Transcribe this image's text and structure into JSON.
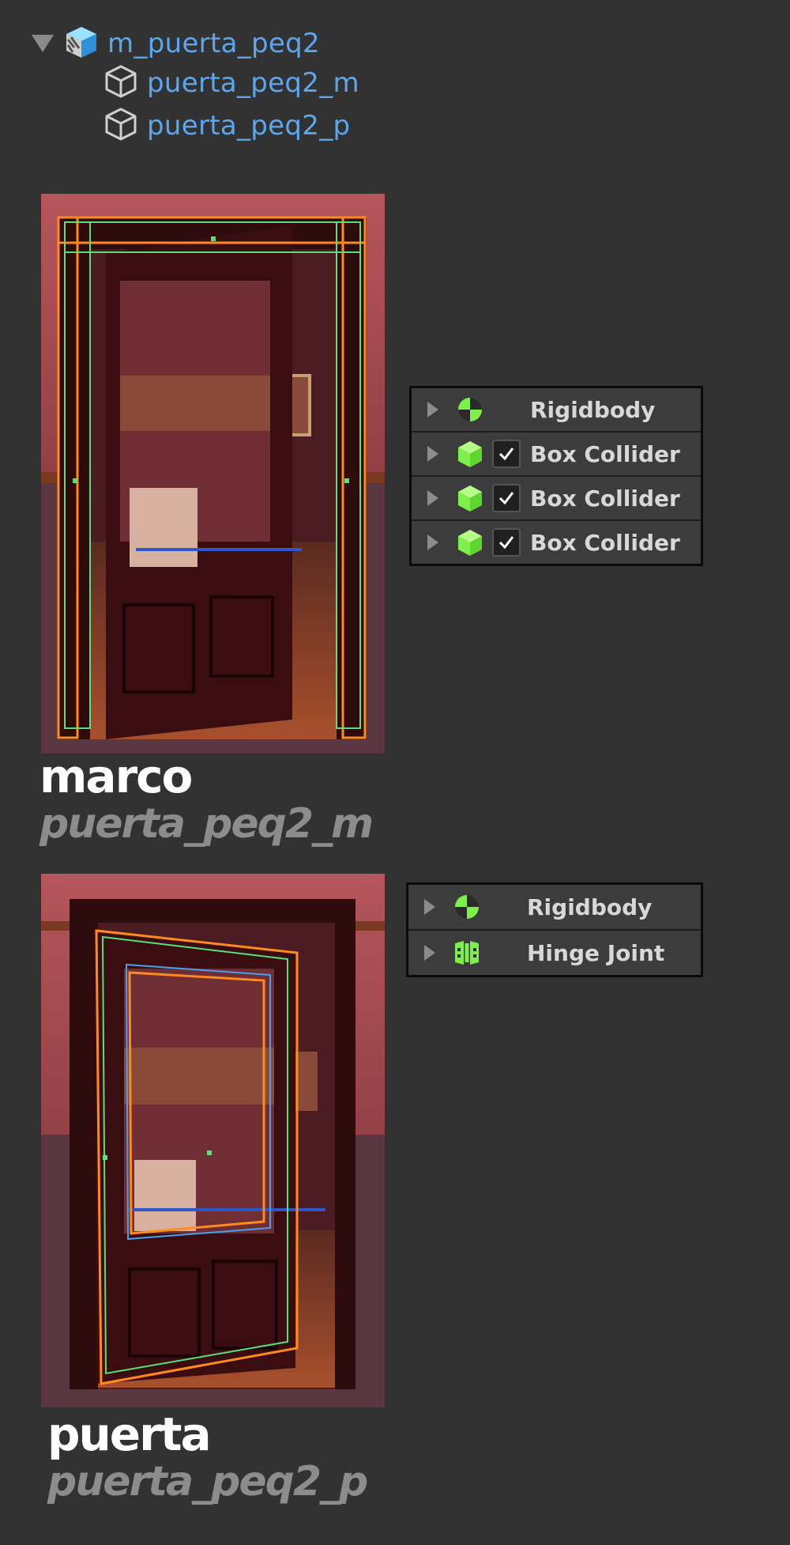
{
  "hierarchy": {
    "root": {
      "label": "m_puerta_peq2",
      "icon": "prefab-icon"
    },
    "children": [
      {
        "label": "puerta_peq2_m",
        "icon": "mesh-cube-icon"
      },
      {
        "label": "puerta_peq2_p",
        "icon": "mesh-cube-icon"
      }
    ]
  },
  "marco": {
    "title": "marco",
    "subtitle": "puerta_peq2_m",
    "components": [
      {
        "label": "Rigidbody",
        "icon": "rigidbody-icon",
        "has_checkbox": false
      },
      {
        "label": "Box Collider",
        "icon": "box-collider-icon",
        "has_checkbox": true,
        "checked": true
      },
      {
        "label": "Box Collider",
        "icon": "box-collider-icon",
        "has_checkbox": true,
        "checked": true
      },
      {
        "label": "Box Collider",
        "icon": "box-collider-icon",
        "has_checkbox": true,
        "checked": true
      }
    ]
  },
  "puerta": {
    "title": "puerta",
    "subtitle": "puerta_peq2_p",
    "components": [
      {
        "label": "Rigidbody",
        "icon": "rigidbody-icon",
        "has_checkbox": false
      },
      {
        "label": "Hinge Joint",
        "icon": "hinge-joint-icon",
        "has_checkbox": false
      }
    ]
  },
  "colors": {
    "background": "#323232",
    "hierarchy_text": "#5aa7ef",
    "component_icon": "#7ef04a",
    "selection_outline": "#ff8a1e",
    "collider_outline": "#58e07a"
  }
}
